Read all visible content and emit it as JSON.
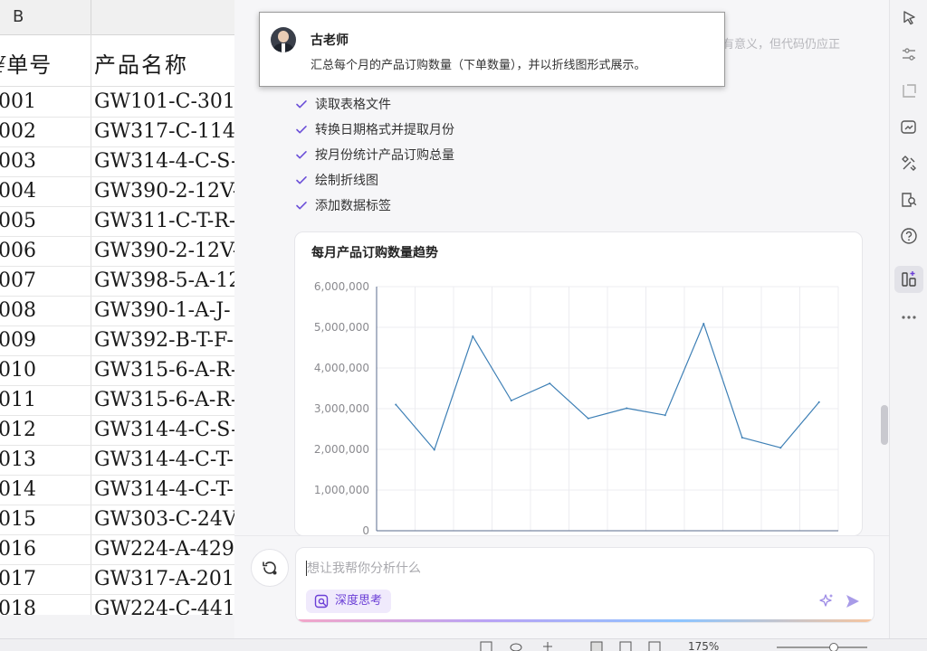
{
  "sheet": {
    "column_label": "B",
    "header": {
      "col_a": "单号",
      "col_a_partial": "¥单号",
      "col_b": "产品名称"
    },
    "rows": [
      {
        "a": "001",
        "b": "GW101-C-301"
      },
      {
        "a": "002",
        "b": "GW317-C-114"
      },
      {
        "a": "003",
        "b": "GW314-4-C-S-"
      },
      {
        "a": "004",
        "b": "GW390-2-12V-"
      },
      {
        "a": "005",
        "b": "GW311-C-T-R-"
      },
      {
        "a": "006",
        "b": "GW390-2-12V-"
      },
      {
        "a": "007",
        "b": "GW398-5-A-12"
      },
      {
        "a": "008",
        "b": "GW390-1-A-J-"
      },
      {
        "a": "009",
        "b": "GW392-B-T-F-"
      },
      {
        "a": "010",
        "b": "GW315-6-A-R-"
      },
      {
        "a": "011",
        "b": "GW315-6-A-R-"
      },
      {
        "a": "012",
        "b": "GW314-4-C-S-"
      },
      {
        "a": "013",
        "b": "GW314-4-C-T-"
      },
      {
        "a": "014",
        "b": "GW314-4-C-T-"
      },
      {
        "a": "015",
        "b": "GW303-C-24VI"
      },
      {
        "a": "016",
        "b": "GW224-A-429"
      },
      {
        "a": "017",
        "b": "GW317-A-201"
      },
      {
        "a": "018",
        "b": "GW224-C-441"
      }
    ]
  },
  "panel": {
    "top_note": "有意义，但代码仍应正",
    "popup": {
      "name": "古老师",
      "message": "汇总每个月的产品订购数量（下单数量），并以折线图形式展示。"
    },
    "steps": [
      "读取表格文件",
      "转换日期格式并提取月份",
      "按月份统计产品订购总量",
      "绘制折线图",
      "添加数据标签"
    ],
    "input": {
      "placeholder": "想让我帮你分析什么",
      "deep_think_label": "深度思考"
    }
  },
  "status_bar": {
    "zoom": "175%"
  },
  "colors": {
    "accent": "#6b3fd6",
    "line": "#3d7fb5",
    "check": "#6b4fd8"
  },
  "chart_data": {
    "type": "line",
    "title": "每月产品订购数量趋势",
    "y_tick_labels": [
      "0",
      "1,000,000",
      "2,000,000",
      "3,000,000",
      "4,000,000",
      "5,000,000",
      "6,000,000"
    ],
    "ylim": [
      0,
      6000000
    ],
    "grid": true,
    "series": [
      {
        "values": [
          3100000,
          1990000,
          4780000,
          3200000,
          3620000,
          2760000,
          3010000,
          2840000,
          5090000,
          2290000,
          2040000,
          3160000
        ]
      }
    ]
  }
}
